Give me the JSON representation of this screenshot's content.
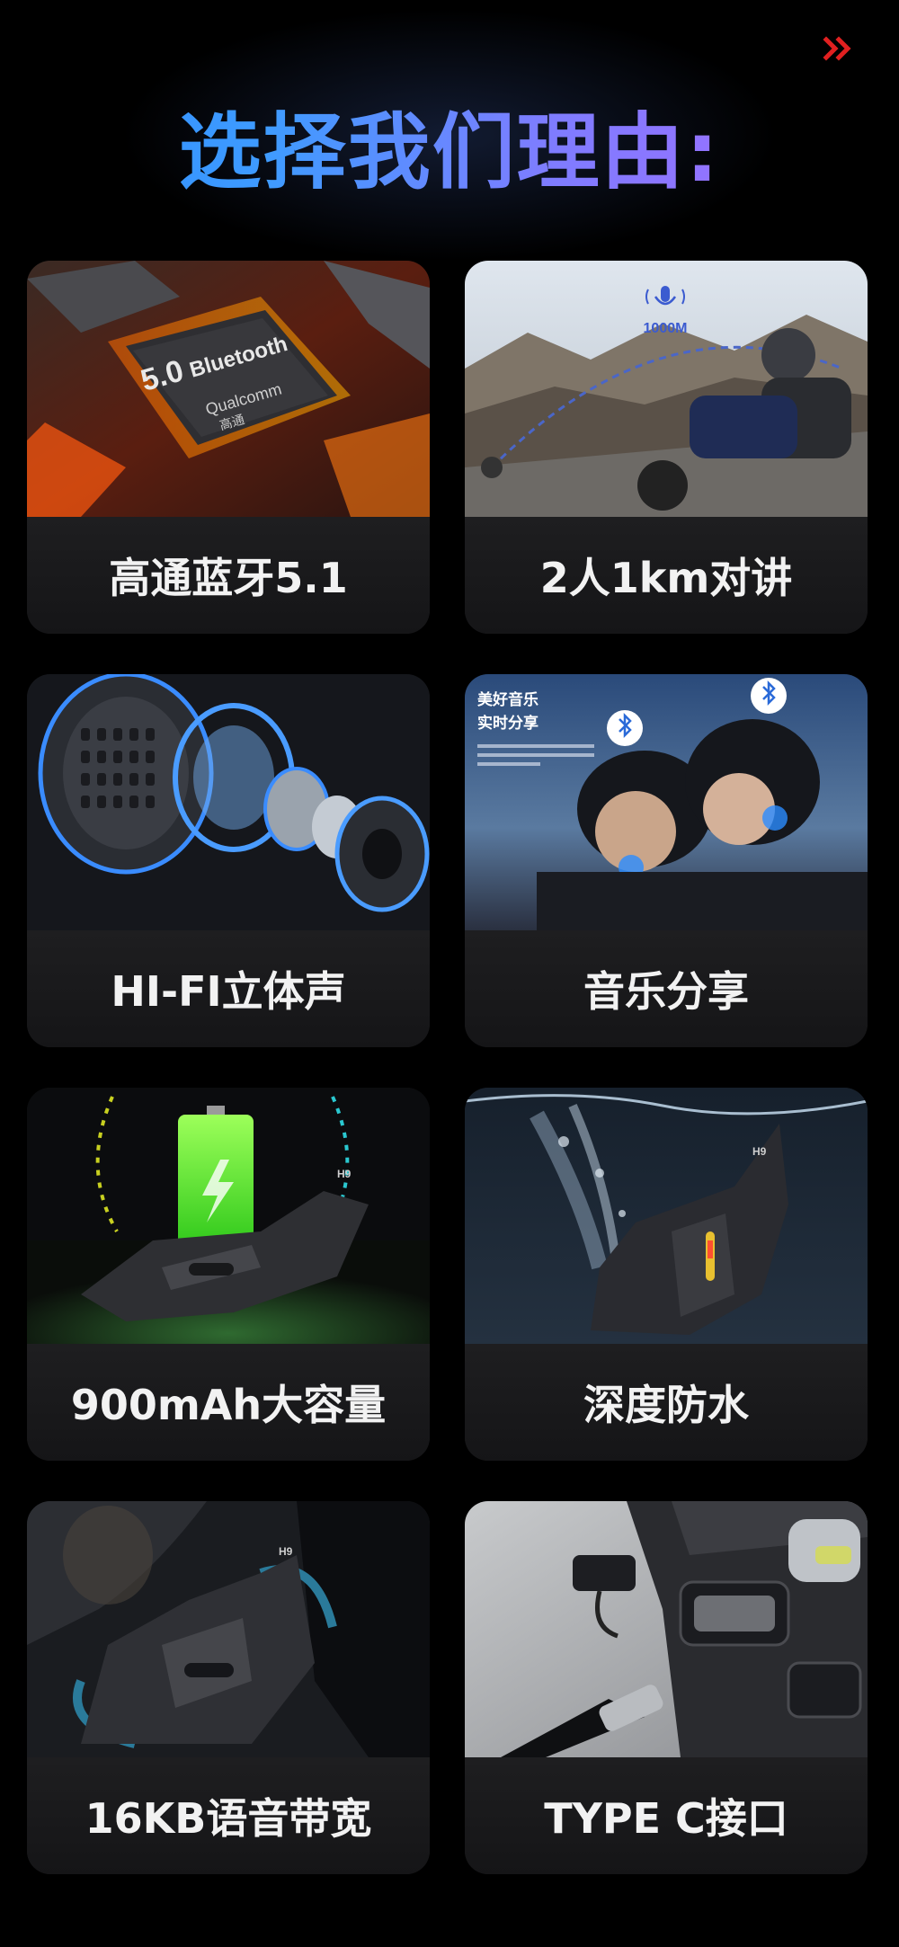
{
  "header": {
    "title": "选择我们理由:",
    "nav_icon": "double-chevron-right-icon"
  },
  "colors": {
    "background": "#000000",
    "title_gradient": [
      "#2a8cff",
      "#a869ff"
    ],
    "card_background": "#1a1a1c",
    "label_text": "#f2f2f2",
    "chevron": "#e02020"
  },
  "features": [
    {
      "label": "高通蓝牙5.1",
      "image": "qualcomm-bluetooth-chip",
      "image_text": {
        "version": "5.0",
        "name": "Bluetooth",
        "brand": "Qualcomm",
        "brand_cn": "高通"
      }
    },
    {
      "label": "2人1km对讲",
      "image": "motorcycle-riders-intercom",
      "image_text": {
        "range": "1000M"
      }
    },
    {
      "label": "HI-FI立体声",
      "image": "speaker-driver-exploded"
    },
    {
      "label": "音乐分享",
      "image": "two-riders-music-share",
      "image_text": {
        "heading_line1": "美好音乐",
        "heading_line2": "实时分享"
      }
    },
    {
      "label": "900mAh大容量",
      "image": "battery-intercom-device",
      "image_text": {
        "model": "H9"
      }
    },
    {
      "label": "深度防水",
      "image": "waterproof-device-splash",
      "image_text": {
        "model": "H9"
      }
    },
    {
      "label": "16KB语音带宽",
      "image": "device-on-helmet",
      "image_text": {
        "model": "H9"
      }
    },
    {
      "label": "TYPE C接口",
      "image": "type-c-port-closeup"
    }
  ]
}
